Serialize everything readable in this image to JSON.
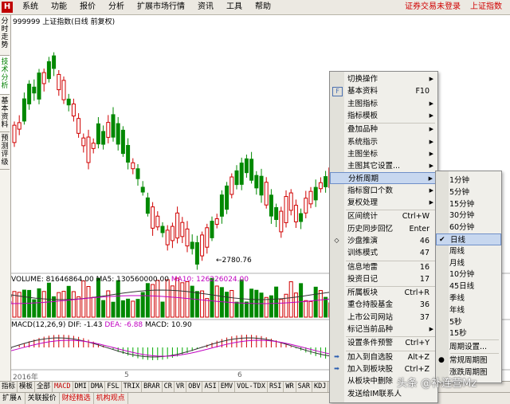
{
  "menubar": {
    "logo": "H",
    "items": [
      "系统",
      "功能",
      "报价",
      "分析",
      "扩展市场行情",
      "资讯",
      "工具",
      "帮助"
    ],
    "right": [
      "证券交易未登录",
      "上证指数"
    ]
  },
  "left_tabs": [
    "分时走势",
    "技术分析",
    "基本资料",
    "预测评级"
  ],
  "chart": {
    "title": "999999 上证指数(日线 前复权)",
    "low_label": "2780.76",
    "volume_label": "VOLUME: 81646864.00",
    "volume_ma5": "MA5: 130560000.00",
    "volume_ma10": "MA10: 126226024.00",
    "macd_label": "MACD(12,26,9)",
    "macd_dif": "DIF: -1.43",
    "macd_dea": "DEA: -6.88",
    "macd_val": "MACD: 10.90",
    "date_labels": [
      "2016年",
      "5",
      "6"
    ]
  },
  "bottom_tabs": [
    "指标",
    "模板",
    "全部",
    "MACD",
    "DMI",
    "DMA",
    "FSL",
    "TRIX",
    "BRAR",
    "CR",
    "VR",
    "OBV",
    "ASI",
    "EMV",
    "VOL-TDX",
    "RSI",
    "WR",
    "SAR",
    "KDJ",
    "C"
  ],
  "status_tabs": [
    "扩展∧",
    "关联报价",
    "财经精选",
    "机构观点"
  ],
  "context_menu": {
    "items": [
      {
        "label": "切换操作",
        "arrow": true
      },
      {
        "label": "基本资料",
        "shortcut": "F10",
        "icon": "F10"
      },
      {
        "label": "主图指标",
        "arrow": true
      },
      {
        "label": "指标模板",
        "arrow": true
      },
      {
        "label": "叠加品种",
        "arrow": true
      },
      {
        "label": "系统指示",
        "arrow": true
      },
      {
        "label": "主图坐标",
        "arrow": true
      },
      {
        "label": "主图其它设置...",
        "arrow": true
      },
      {
        "label": "分析周期",
        "arrow": true,
        "highlight": true
      },
      {
        "label": "指标窗口个数",
        "arrow": true
      },
      {
        "label": "复权处理",
        "arrow": true
      },
      {
        "label": "区间统计",
        "shortcut": "Ctrl+W"
      },
      {
        "label": "历史同步回忆",
        "shortcut": "Enter"
      },
      {
        "label": "沙盘推演",
        "shortcut": "46",
        "icon": "box"
      },
      {
        "label": "训练模式",
        "shortcut": "47"
      },
      {
        "label": "信息地雷",
        "shortcut": "16"
      },
      {
        "label": "投资日记",
        "shortcut": "17"
      },
      {
        "label": "所属板块",
        "shortcut": "Ctrl+R"
      },
      {
        "label": "重仓持股基金",
        "shortcut": "36"
      },
      {
        "label": "上市公司网站",
        "shortcut": "37"
      },
      {
        "label": "标记当前品种",
        "arrow": true
      },
      {
        "label": "设置条件预警",
        "shortcut": "Ctrl+Y"
      },
      {
        "label": "加入到自选股",
        "shortcut": "Alt+Z",
        "icon": "add"
      },
      {
        "label": "加入到板块股",
        "shortcut": "Ctrl+Z",
        "icon": "add"
      },
      {
        "label": "从板块中删除"
      },
      {
        "label": "发送给IM联系人"
      }
    ]
  },
  "period_submenu": {
    "items": [
      {
        "label": "1分钟"
      },
      {
        "label": "5分钟"
      },
      {
        "label": "15分钟"
      },
      {
        "label": "30分钟"
      },
      {
        "label": "60分钟"
      },
      {
        "label": "日线",
        "checked": true,
        "highlight": true
      },
      {
        "label": "周线"
      },
      {
        "label": "月线"
      },
      {
        "label": "10分钟"
      },
      {
        "label": "45日线"
      },
      {
        "label": "季线"
      },
      {
        "label": "年线"
      },
      {
        "label": "5秒"
      },
      {
        "label": "15秒"
      },
      {
        "label": "周期设置..."
      },
      {
        "label": "常规周期图",
        "dot": true
      },
      {
        "label": "涨跌周期图"
      }
    ]
  },
  "watermark": "头条 @补连营Mz",
  "colors": {
    "up": "#d00000",
    "down": "#008800",
    "menu_bg": "#f0efea",
    "highlight": "#c7d7ef"
  }
}
